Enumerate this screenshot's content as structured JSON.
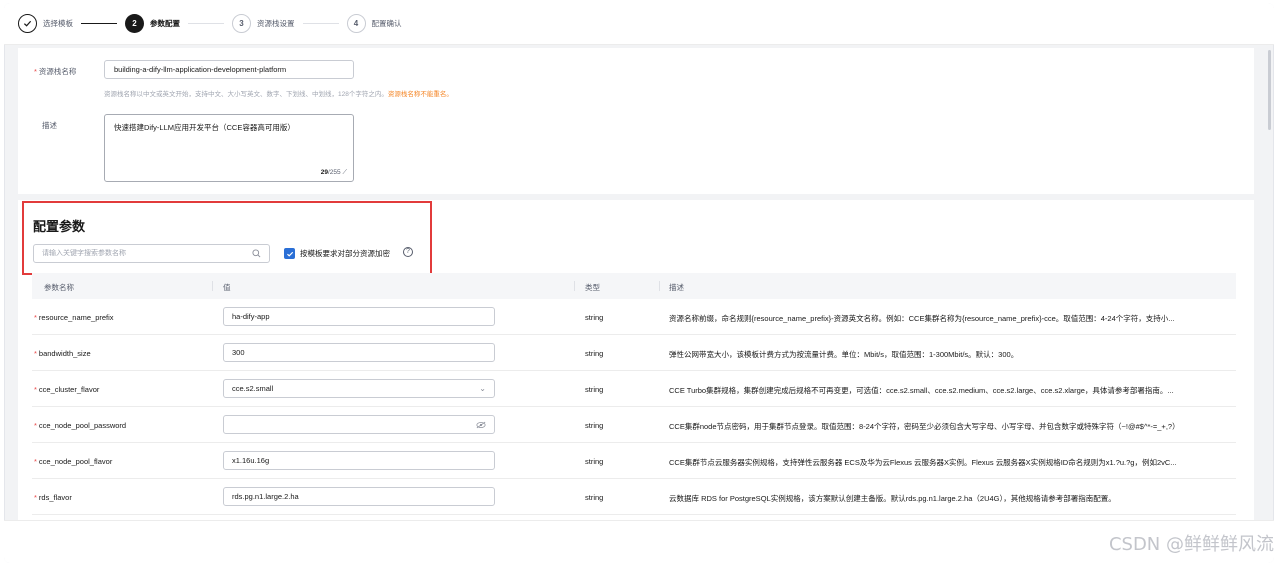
{
  "steps": [
    {
      "num": "✓",
      "label": "选择模板",
      "state": "done"
    },
    {
      "num": "2",
      "label": "参数配置",
      "state": "active"
    },
    {
      "num": "3",
      "label": "资源栈设置",
      "state": "todo"
    },
    {
      "num": "4",
      "label": "配置确认",
      "state": "todo"
    }
  ],
  "form": {
    "name_label": "资源栈名称",
    "name_value": "building-a-dify-llm-application-development-platform",
    "name_hint": "资源栈名称以中文或英文开始，支持中文、大小写英文、数字、下划线、中划线，128个字符之内。",
    "name_hint_warn": "资源栈名称不能重名。",
    "desc_label": "描述",
    "desc_value": "快速搭建Dify-LLM应用开发平台（CCE容器高可用版）",
    "desc_count_current": "29",
    "desc_count_max": "/255"
  },
  "params": {
    "title": "配置参数",
    "search_placeholder": "请输入关键字搜索参数名称",
    "encrypt_label": "按模板要求对部分资源加密",
    "columns": {
      "name": "参数名称",
      "value": "值",
      "type": "类型",
      "desc": "描述"
    },
    "rows": [
      {
        "name": "resource_name_prefix",
        "value": "ha-dify-app",
        "type": "string",
        "desc": "资源名称前缀，命名规则{resource_name_prefix}-资源英文名称。例如：CCE集群名称为{resource_name_prefix}-cce。取值范围：4-24个字符，支持小..."
      },
      {
        "name": "bandwidth_size",
        "value": "300",
        "type": "string",
        "desc": "弹性公网带宽大小，该模板计费方式为按流量计费。单位：Mbit/s，取值范围：1-300Mbit/s。默认：300。"
      },
      {
        "name": "cce_cluster_flavor",
        "value": "cce.s2.small",
        "type": "string",
        "desc": "CCE Turbo集群规格，集群创建完成后规格不可再变更，可选值：cce.s2.small、cce.s2.medium、cce.s2.large、cce.s2.xlarge，具体请参考部署指南。..."
      },
      {
        "name": "cce_node_pool_password",
        "value": "",
        "type": "string",
        "desc": "CCE集群node节点密码，用于集群节点登录。取值范围：8-24个字符，密码至少必须包含大写字母、小写字母、并包含数字或特殊字符（~!@#$^*-=_+,?）"
      },
      {
        "name": "cce_node_pool_flavor",
        "value": "x1.16u.16g",
        "type": "string",
        "desc": "CCE集群节点云服务器实例规格，支持弹性云服务器 ECS及华为云Flexus 云服务器X实例。Flexus 云服务器X实例规格ID命名规则为x1.?u.?g，例如2vC..."
      },
      {
        "name": "rds_flavor",
        "value": "rds.pg.n1.large.2.ha",
        "type": "string",
        "desc": "云数据库 RDS for PostgreSQL实例规格，该方案默认创建主备版。默认rds.pg.n1.large.2.ha（2U4G），其他规格请参考部署指南配置。"
      }
    ]
  },
  "watermark": "CSDN @鲜鲜鲜风流"
}
